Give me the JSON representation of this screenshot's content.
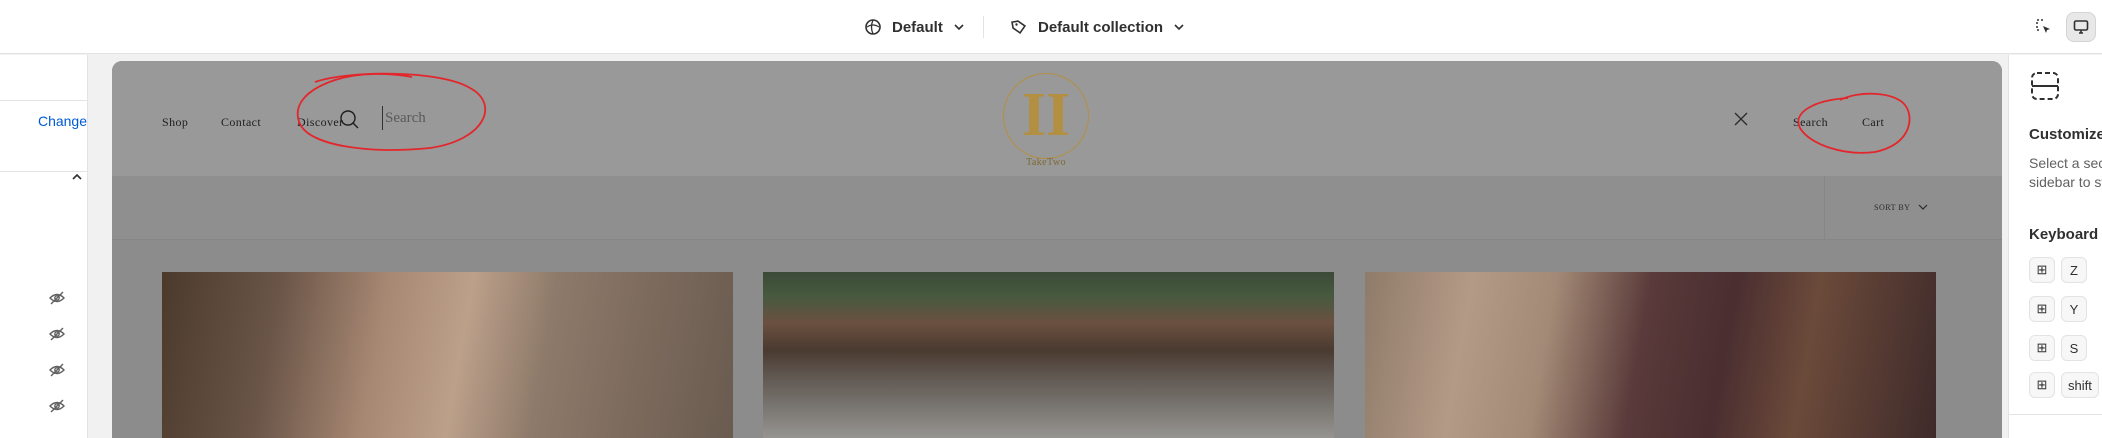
{
  "topbar": {
    "theme_label": "Default",
    "template_label": "Default collection",
    "icons": [
      "globe-icon",
      "tag-icon",
      "chevron-down-icon",
      "inspector-icon",
      "desktop-preview-icon"
    ]
  },
  "left_panel": {
    "change_label": "Change",
    "icons": [
      "collapse-chevron-icon",
      "hidden-eye-icon"
    ]
  },
  "storefront": {
    "nav": {
      "shop": "Shop",
      "contact": "Contact",
      "discover": "Discover"
    },
    "search_placeholder": "Search",
    "logo_text": "TakeTwo",
    "header_search": "Search",
    "header_cart": "Cart",
    "sort_label": "SORT BY",
    "colors": {
      "logo_gold": "#b38f42",
      "overlay": "#999999",
      "annotation_red": "#e3262b"
    }
  },
  "right_panel": {
    "title": "Customize",
    "desc_line1": "Select a sec",
    "desc_line2": "sidebar to st",
    "keyboard_title": "Keyboard s",
    "shortcuts": [
      {
        "mod": "⊞",
        "key": "Z"
      },
      {
        "mod": "⊞",
        "key": "Y"
      },
      {
        "mod": "⊞",
        "key": "S"
      },
      {
        "mod": "⊞",
        "key": "shift"
      }
    ]
  }
}
